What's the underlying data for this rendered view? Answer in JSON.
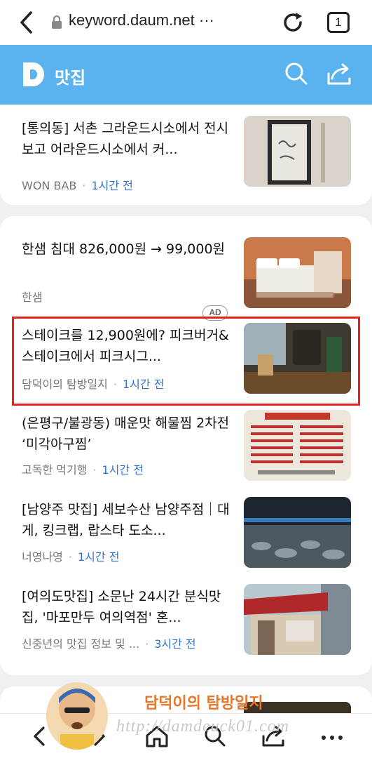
{
  "browser": {
    "url": "keyword.daum.net ···",
    "tab_count": "1"
  },
  "header": {
    "title": "맛집"
  },
  "top_item": {
    "title": "[통의동] 서촌 그라운드시소에서 전시보고 어라운드시소에서 커...",
    "source": "WON BAB",
    "time": "1시간 전"
  },
  "ad_item": {
    "title": "한샘 침대 826,000원 → 99,000원",
    "source": "한샘",
    "badge": "AD"
  },
  "items": [
    {
      "title": "스테이크를 12,900원에? 피크버거&스테이크에서 피크시그...",
      "source": "담덕이의 탐방일지",
      "time": "1시간 전"
    },
    {
      "title": "(은평구/불광동) 매운맛 해물찜 2차전 ‘미각아구찜’",
      "source": "고독한 먹기행",
      "time": "1시간 전"
    },
    {
      "title": "[남양주 맛집] 세보수산 남양주점｜대게, 킹크랩, 랍스타 도소...",
      "source": "너영나영",
      "time": "1시간 전"
    },
    {
      "title": "[여의도맛집] 소문난 24시간 분식맛집, '마포만두 여의역점' 혼...",
      "source": "신중년의 맛집 정보 및 ...",
      "time": "3시간 전"
    }
  ],
  "watermark": {
    "title": "담덕이의 탐방일지",
    "url": "http://damdeuck01.com"
  },
  "colors": {
    "header_bg": "#5ab3ee",
    "time_blue": "#2f72d3",
    "highlight_red": "#e32222"
  }
}
